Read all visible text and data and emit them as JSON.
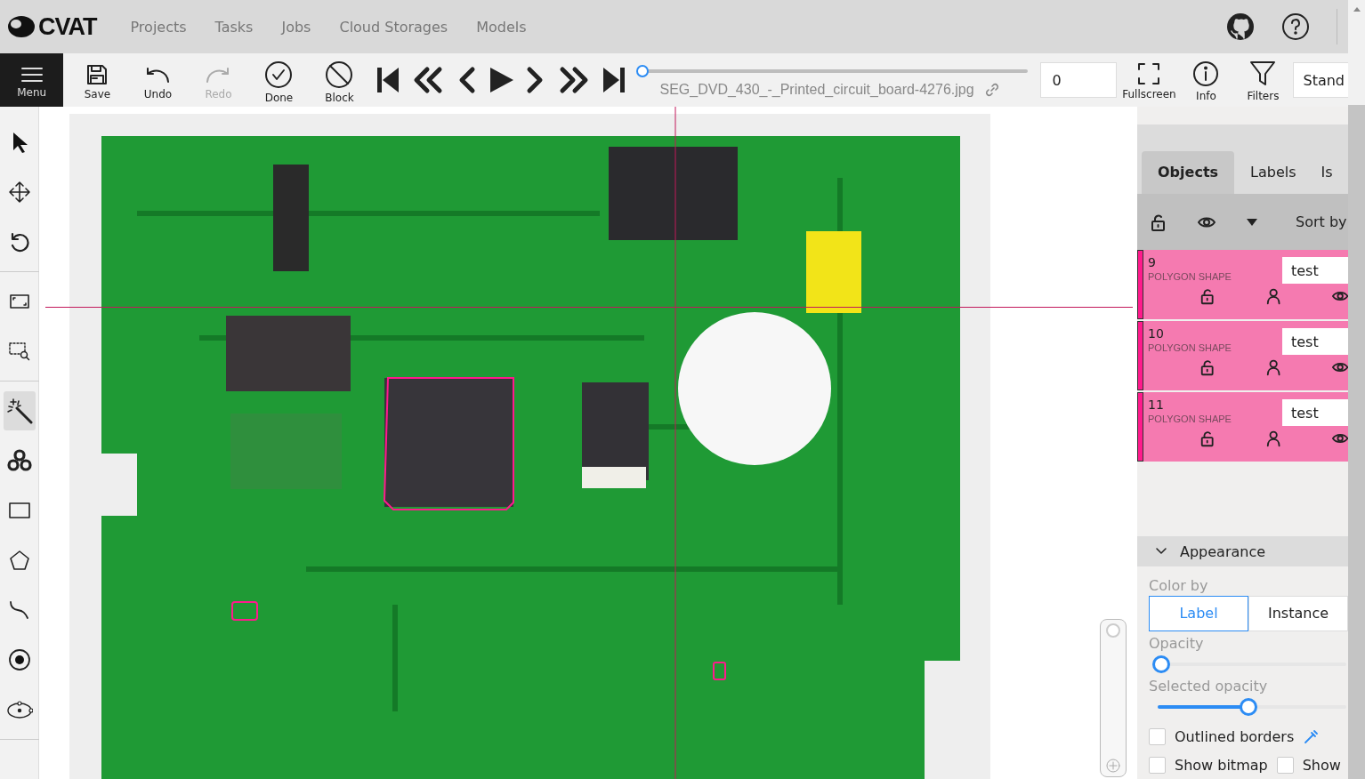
{
  "header": {
    "logo": "CVAT",
    "nav": [
      {
        "label": "Projects"
      },
      {
        "label": "Tasks"
      },
      {
        "label": "Jobs"
      },
      {
        "label": "Cloud Storages"
      },
      {
        "label": "Models"
      }
    ],
    "icons": [
      {
        "kind": "github"
      },
      {
        "kind": "help"
      }
    ]
  },
  "toolbar": {
    "menu": "Menu",
    "actions": [
      {
        "kind": "save",
        "label": "Save",
        "disabled": false
      },
      {
        "kind": "undo",
        "label": "Undo",
        "disabled": false
      },
      {
        "kind": "redo",
        "label": "Redo",
        "disabled": true
      },
      {
        "kind": "done",
        "label": "Done",
        "disabled": false
      },
      {
        "kind": "block",
        "label": "Block",
        "disabled": false
      }
    ],
    "player": [
      {
        "kind": "first"
      },
      {
        "kind": "fast-back"
      },
      {
        "kind": "prev"
      },
      {
        "kind": "play"
      },
      {
        "kind": "next"
      },
      {
        "kind": "fast-forward"
      },
      {
        "kind": "last"
      }
    ],
    "frame_slider": {
      "level": 0
    },
    "filename": "SEG_DVD_430_-_Printed_circuit_board-4276.jpg",
    "frame": "0",
    "views": [
      {
        "kind": "fullscreen",
        "label": "Fullscreen"
      },
      {
        "kind": "info",
        "label": "Info"
      },
      {
        "kind": "filters",
        "label": "Filters"
      }
    ],
    "workspace": "Stand"
  },
  "tools": [
    {
      "kind": "cursor",
      "selected": false
    },
    {
      "kind": "move",
      "selected": false
    },
    {
      "kind": "rotate",
      "selected": false
    },
    {
      "kind": "divider"
    },
    {
      "kind": "fit",
      "selected": false
    },
    {
      "kind": "zoom-region",
      "selected": false
    },
    {
      "kind": "divider"
    },
    {
      "kind": "magic",
      "selected": true
    },
    {
      "kind": "openvino",
      "selected": false
    },
    {
      "kind": "rectangle",
      "selected": false
    },
    {
      "kind": "polygon",
      "selected": false
    },
    {
      "kind": "polyline",
      "selected": false
    },
    {
      "kind": "points",
      "selected": false
    },
    {
      "kind": "ellipse",
      "selected": false
    },
    {
      "kind": "divider"
    }
  ],
  "sidebar": {
    "tabs": [
      {
        "label": "Objects",
        "selected": true
      },
      {
        "label": "Labels",
        "selected": false
      },
      {
        "label": "Is",
        "selected": false
      }
    ],
    "sort": "Sort by",
    "objects": [
      {
        "id": "9",
        "type": "POLYGON SHAPE",
        "label": "test",
        "color": "#ff1a8c"
      },
      {
        "id": "10",
        "type": "POLYGON SHAPE",
        "label": "test",
        "color": "#ff1a8c"
      },
      {
        "id": "11",
        "type": "POLYGON SHAPE",
        "label": "test",
        "color": "#ff1a8c"
      }
    ],
    "appearance": {
      "title": "Appearance",
      "expanded": true,
      "color_by": "Color by",
      "color_options": [
        {
          "label": "Label",
          "selected": true
        },
        {
          "label": "Instance",
          "selected": false
        }
      ],
      "opacity": {
        "label": "Opacity",
        "level": 0.02
      },
      "selected_opacity": {
        "label": "Selected opacity",
        "level": 0.48
      },
      "checkboxes": [
        {
          "label": "Outlined borders",
          "checked": false,
          "picker": true
        },
        {
          "label": "Show bitmap",
          "checked": false
        },
        {
          "label": "Show",
          "checked": false
        }
      ]
    }
  }
}
